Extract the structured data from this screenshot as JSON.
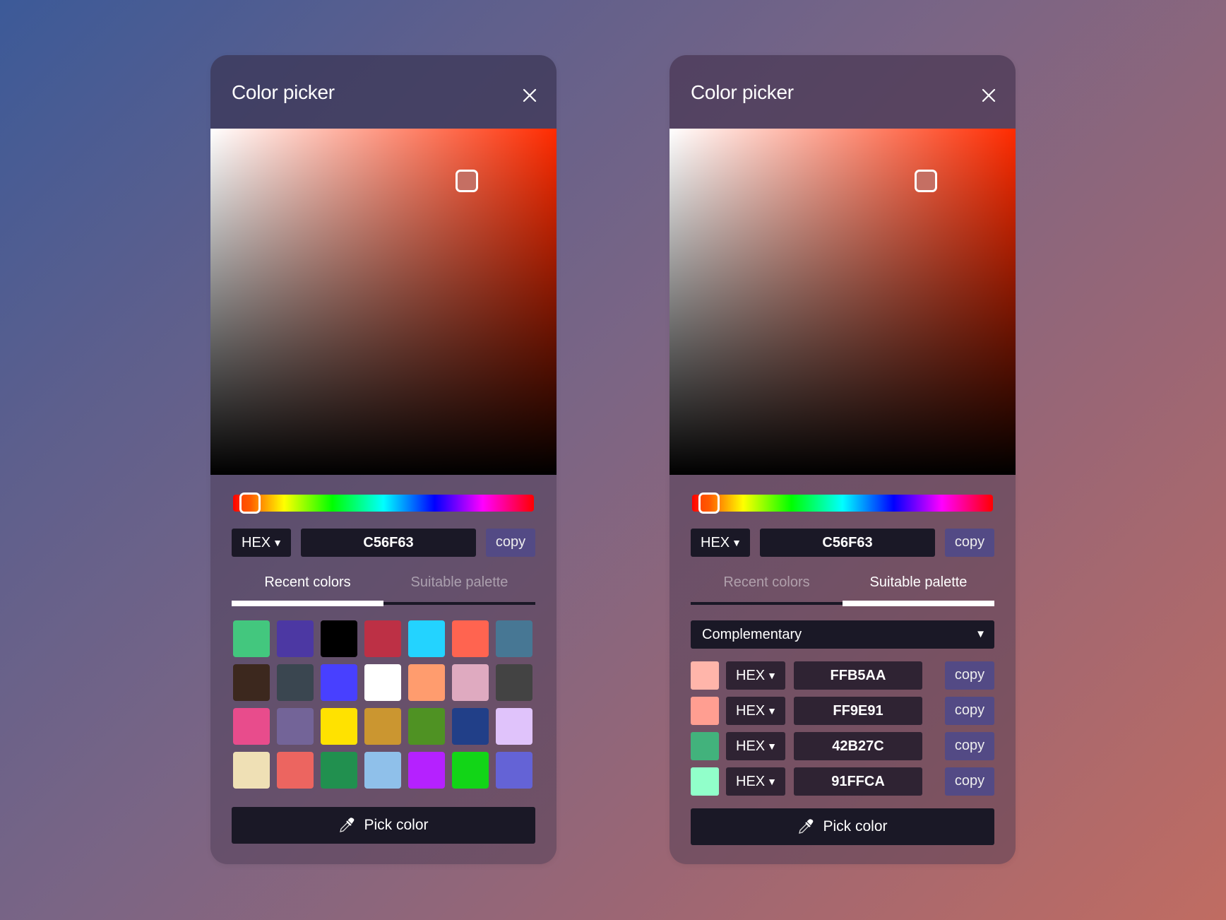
{
  "colors": {
    "hue_base": "#FF2B00",
    "hue_thumb": "#FF5A00",
    "accent_button": "#534A85",
    "input_bg": "#1A1826"
  },
  "panels": [
    {
      "id": "recent",
      "title": "Color picker",
      "close_icon": "close-icon",
      "sv_marker": {
        "saturation": 0.74,
        "value": 0.85
      },
      "hue_position": 0.02,
      "format": "HEX",
      "hex_value": "C56F63",
      "copy_label": "copy",
      "tabs": [
        {
          "label": "Recent colors",
          "active": true
        },
        {
          "label": "Suitable palette",
          "active": false
        }
      ],
      "recent_colors": [
        "#43C77E",
        "#4C38A3",
        "#000000",
        "#BD3045",
        "#23D3FF",
        "#FF6450",
        "#477794",
        "#3C281E",
        "#3A4650",
        "#4840FF",
        "#FFFFFF",
        "#FF9C6E",
        "#DFAAC0",
        "#434343",
        "#E84C8C",
        "#736498",
        "#FFE200",
        "#CB9630",
        "#4F9223",
        "#213F88",
        "#E0C3FB",
        "#EFE0B5",
        "#EC6560",
        "#21904F",
        "#8FC0EA",
        "#B521FF",
        "#12D517",
        "#6463D6"
      ],
      "pick_label": "Pick color",
      "pick_icon": "eyedropper-icon"
    },
    {
      "id": "palette",
      "title": "Color picker",
      "close_icon": "close-icon",
      "sv_marker": {
        "saturation": 0.74,
        "value": 0.85
      },
      "hue_position": 0.02,
      "format": "HEX",
      "hex_value": "C56F63",
      "copy_label": "copy",
      "tabs": [
        {
          "label": "Recent colors",
          "active": false
        },
        {
          "label": "Suitable palette",
          "active": true
        }
      ],
      "scheme": "Complementary",
      "palette": [
        {
          "swatch": "#FFB5AA",
          "format": "HEX",
          "value": "FFB5AA",
          "copy_label": "copy"
        },
        {
          "swatch": "#FF9E91",
          "format": "HEX",
          "value": "FF9E91",
          "copy_label": "copy"
        },
        {
          "swatch": "#42B27C",
          "format": "HEX",
          "value": "42B27C",
          "copy_label": "copy"
        },
        {
          "swatch": "#91FFCA",
          "format": "HEX",
          "value": "91FFCA",
          "copy_label": "copy"
        }
      ],
      "pick_label": "Pick color",
      "pick_icon": "eyedropper-icon"
    }
  ]
}
